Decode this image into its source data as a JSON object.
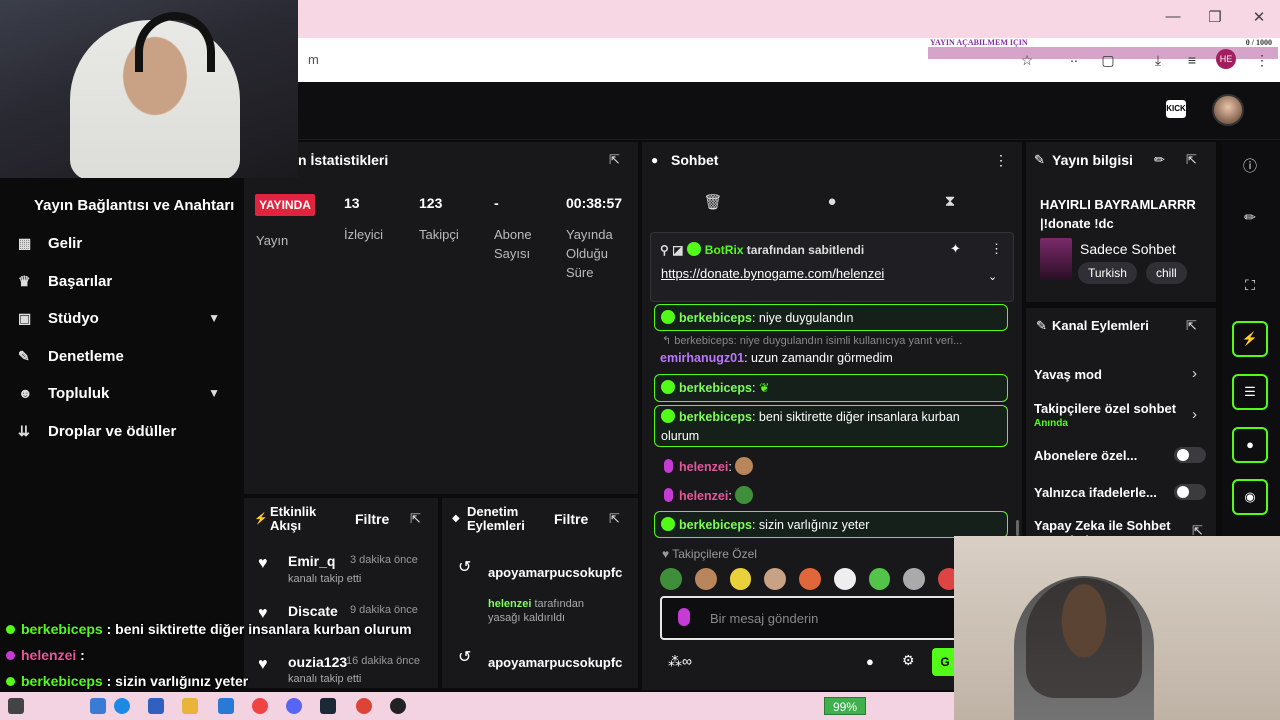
{
  "browser": {
    "address": "m",
    "promo_text": "YAYIN AÇABILMEM IÇIN",
    "promo_count": "0 / 1000",
    "profile_initials": "HE",
    "window_controls": [
      "—",
      "❐",
      "✕"
    ]
  },
  "topbar": {
    "logo_text": "KICK"
  },
  "sidebar": {
    "title": "Yayın Bağlantısı ve Anahtarı",
    "items": [
      {
        "label": "Gelir",
        "icon": "revenue-icon",
        "glyph": "▦"
      },
      {
        "label": "Başarılar",
        "icon": "trophy-icon",
        "glyph": "🏆"
      },
      {
        "label": "Stüdyo",
        "icon": "studio-icon",
        "glyph": "▣",
        "expandable": true
      },
      {
        "label": "Denetleme",
        "icon": "wrench-icon",
        "glyph": "🔧"
      },
      {
        "label": "Topluluk",
        "icon": "community-icon",
        "glyph": "👥",
        "expandable": true
      },
      {
        "label": "Droplar ve ödüller",
        "icon": "drops-icon",
        "glyph": "⇊"
      }
    ]
  },
  "stats": {
    "title": "n İstatistikleri",
    "live_badge": "YAYINDA",
    "columns": [
      {
        "value": "",
        "label": "Yayın"
      },
      {
        "value": "13",
        "label": "İzleyici"
      },
      {
        "value": "123",
        "label": "Takipçi"
      },
      {
        "value": "-",
        "label": "Abone Sayısı"
      },
      {
        "value": "00:38:57",
        "label": "Yayında Olduğu Süre"
      }
    ]
  },
  "activity": {
    "title": "Etkinlik Akışı",
    "filter": "Filtre",
    "items": [
      {
        "name": "Emir_q",
        "time": "3 dakika önce",
        "sub": "kanalı takip etti"
      },
      {
        "name": "Discate",
        "time": "9 dakika önce",
        "sub": "kanalı takip etti"
      },
      {
        "name": "ouzia123",
        "time": "16 dakika önce",
        "sub": "kanalı takip etti"
      }
    ]
  },
  "moderation": {
    "title": "Denetim Eylemleri",
    "filter": "Filtre",
    "items": [
      {
        "name": "apoyamarpucsokupfc",
        "by": "helenzei",
        "sub": " tarafından",
        "sub2": "yasağı kaldırıldı"
      },
      {
        "name": "apoyamarpucsokupfc"
      }
    ]
  },
  "chat": {
    "title": "Sohbet",
    "pinned_by": "BotRix",
    "pinned_suffix": " tarafından sabitlendi",
    "pinned_link": "https://donate.bynogame.com/helenzei",
    "reply_line": "↰ berkebiceps: niye duygulandın isimli kullanıcıya yanıt veri...",
    "messages": [
      {
        "user": "berkebiceps",
        "text": ": niye duygulandın"
      },
      {
        "user": "emirhanugz01",
        "text": ": uzun zamandır görmedim"
      },
      {
        "user": "berkebiceps",
        "text": ":"
      },
      {
        "user": "berkebiceps",
        "text": ": beni siktirette diğer insanlara kurban",
        "text2": "olurum"
      },
      {
        "user": "helenzei",
        "text": ":"
      },
      {
        "user": "helenzei",
        "text": ":"
      },
      {
        "user": "berkebiceps",
        "text": ": sizin varlığınız yeter"
      }
    ],
    "followers_only": "♥ Takipçilere Özel",
    "input_placeholder": "Bir mesaj gönderin",
    "send_label": "G",
    "emote_colors": [
      "#3f8f3a",
      "#b8865a",
      "#e8d13a",
      "#c9a184",
      "#e0673a",
      "#eeeeee",
      "#53c44a",
      "#aaaaaa",
      "#d44"
    ]
  },
  "stream_info": {
    "title": "Yayın bilgisi",
    "stream_title": "HAYIRLI BAYRAMLARRR |!donate !dc",
    "category": "Sadece Sohbet",
    "tags": [
      "Turkish",
      "chill"
    ]
  },
  "channel_actions": {
    "title": "Kanal Eylemleri",
    "items": [
      {
        "label": "Yavaş mod",
        "type": "chevron"
      },
      {
        "label": "Takipçilere özel sohbet",
        "sub": "Anında",
        "type": "chevron"
      },
      {
        "label": "Abonelere özel...",
        "type": "toggle"
      },
      {
        "label": "Yalnızca ifadelerle...",
        "type": "toggle"
      },
      {
        "label": "Yapay Zeka ile Sohbet Denetimi",
        "type": "link"
      }
    ]
  },
  "overlay_chat": [
    {
      "user": "berkebiceps",
      "text": " : beni siktirette diğer insanlara kurban olurum",
      "color": "#53fc18"
    },
    {
      "user": "helenzei",
      "text": " :",
      "color": "#c63bd6"
    },
    {
      "user": "berkebiceps",
      "text": " : sizin varlığınız yeter",
      "color": "#53fc18"
    }
  ],
  "taskbar": {
    "battery": "99%"
  }
}
